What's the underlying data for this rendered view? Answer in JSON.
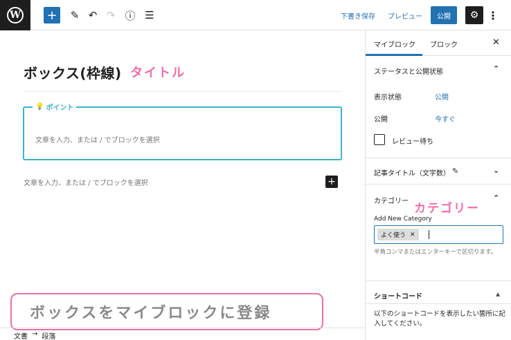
{
  "toolbar": {
    "logo": "W",
    "save_draft": "下書き保存",
    "preview": "プレビュー",
    "publish": "公開"
  },
  "editor": {
    "title": "ボックス(枠線)",
    "title_annotation": "タイトル",
    "point_label": "ポイント",
    "point_placeholder": "文章を入力、または / でブロックを選択",
    "paragraph_placeholder": "文章を入力、または / でブロックを選択"
  },
  "annotation": {
    "bottom_banner": "ボックスをマイブロックに登録",
    "category": "カテゴリー"
  },
  "breadcrumb": [
    "文書",
    "→",
    "段落"
  ],
  "sidebar": {
    "tabs": [
      "マイブロック",
      "ブロック"
    ],
    "status_section": "ステータスと公開状態",
    "visibility_label": "表示状態",
    "visibility_value": "公開",
    "publish_label": "公開",
    "publish_value": "今すぐ",
    "pending_review": "レビュー待ち",
    "post_title_section": "記事タイトル（文字数）",
    "category_section": "カテゴリー",
    "add_new_category": "Add New Category",
    "token": "よく使う",
    "help_text": "半角コンマまたはエンターキーで区切ります。",
    "shortcode_section": "ショートコード",
    "shortcode_desc": "以下のショートコードを表示したい箇所に記入してください。"
  }
}
